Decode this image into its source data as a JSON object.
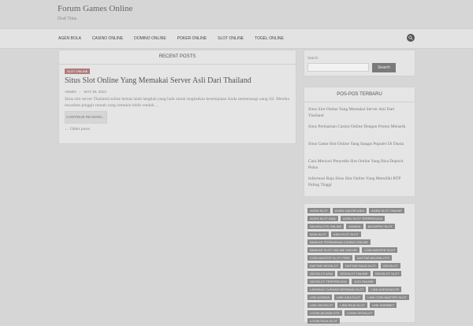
{
  "site": {
    "title": "Forum Games Online",
    "description": "Draf Titus"
  },
  "nav": {
    "items": [
      "AGEN BOLA",
      "CASINO ONLINE",
      "DOMINO ONLINE",
      "POKER ONLINE",
      "SLOT ONLINE",
      "TOGEL ONLINE"
    ],
    "search_icon": "search-icon"
  },
  "main": {
    "heading": "RECENT POSTS",
    "post": {
      "category": "SLOT ONLINE",
      "title": "Situs Slot Online Yang Memakai Server Asli Dari Thailand",
      "author": "ADMIN",
      "separator": "-",
      "date": "MAY 30, 2023",
      "excerpt": "Situs slot server Thailand online hemat ialah langkah yang baik untuk tingkatkan kesempatan Anda memenangi uang riil. Mereka tawarkan pinggir rumah yang semakin lebih rendah…",
      "read_more": "CONTINUE READING…"
    },
    "older_posts": "← Older posts"
  },
  "sidebar": {
    "search": {
      "label": "Search",
      "placeholder": "",
      "button": "Search"
    },
    "recent": {
      "heading": "POS-POS TERBARU",
      "items": [
        "Situs Slot Online Yang Memakai Server Asli Dari Thailand",
        "Situs Permainan Casino Online Dengan Promo Menarik",
        "Situs Game Slot Online Yang Sangat Populer Di Dunia",
        "Cara Mencari Penyedia Slot Online Yang Bisa Deposit Pulsa",
        "Informasi Raja Situs Slot Online Yang Memiliki RTP Paling Tinggi"
      ]
    },
    "tags": [
      "AGEN SLOT",
      "AGEN GACOR ASIA",
      "AGEN SLOT ONLINE",
      "AGEN SLOT ASIA",
      "AGEN SLOT TERPERCAYA",
      "AKUNSLOTS ONLINE",
      "AGNIDA",
      "AKUNPRO SLOT",
      "AGIA SLOT",
      "ASIA SLOT SLOT",
      "BANDAR PERMAINAN CASINO ONLINE",
      "BANDAR SLOT ONLINE GACOR",
      "COIN MASTER SLOT",
      "COIN MASTER SLOT FREE",
      "DAFTAR AKUNSLOTS",
      "DAFTAR GEGSLOT",
      "DAFTAR RAJA SLOT",
      "GEGSLOT",
      "GEGSLOT ASIA",
      "GEGSLOT ONLINE",
      "GEGSLOT SLOT",
      "GEGSLOT TERPERCAYA",
      "JUDI ONLINE",
      "LANGKAH CURANG BERMAIN SLOT",
      "LINK AGENGACOR",
      "LINK AGNIDA",
      "LINK ASIA SLOT",
      "LINK COIN MASTER SLOT",
      "LINK GEGSLOT",
      "LINK RAJA SLOT",
      "LINK WINSBET",
      "LOGIN AKUNSLOTS",
      "LOGIN GEGSLOT",
      "LOGIN RAJA SLOT"
    ]
  },
  "colors": {
    "background": "#d6d6d6",
    "panel": "#e5e5e5",
    "badge": "#b07a7a",
    "tag": "#8a8a8a"
  }
}
